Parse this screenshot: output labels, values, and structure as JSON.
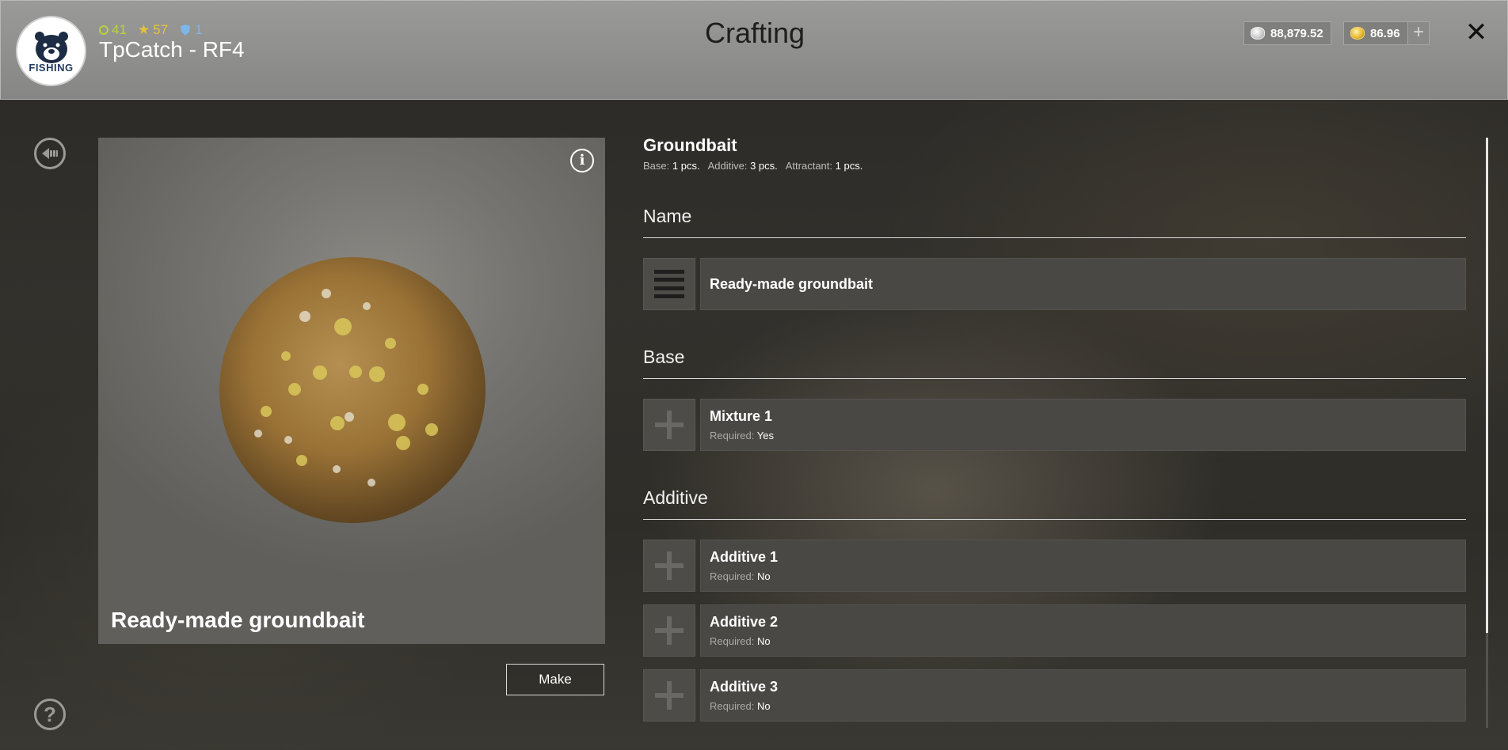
{
  "header": {
    "title": "Crafting",
    "player_name": "TpCatch - RF4",
    "stats": {
      "xp": "41",
      "rank": "57",
      "shield": "1"
    },
    "currency": {
      "silver": "88,879.52",
      "gold": "86.96",
      "add_label": "+"
    },
    "close_label": "✕",
    "logo_text": "FISHING"
  },
  "preview": {
    "item_name": "Ready-made groundbait",
    "info_label": "i",
    "make_label": "Make"
  },
  "recipe": {
    "title": "Groundbait",
    "counts": {
      "base_label": "Base:",
      "base_value": "1 pcs.",
      "additive_label": "Additive:",
      "additive_value": "3 pcs.",
      "attractant_label": "Attractant:",
      "attractant_value": "1 pcs."
    },
    "name_section": {
      "label": "Name",
      "value": "Ready-made groundbait"
    },
    "base_section": {
      "label": "Base",
      "slots": [
        {
          "title": "Mixture 1",
          "required_label": "Required:",
          "required_value": "Yes"
        }
      ]
    },
    "additive_section": {
      "label": "Additive",
      "slots": [
        {
          "title": "Additive 1",
          "required_label": "Required:",
          "required_value": "No"
        },
        {
          "title": "Additive 2",
          "required_label": "Required:",
          "required_value": "No"
        },
        {
          "title": "Additive 3",
          "required_label": "Required:",
          "required_value": "No"
        }
      ]
    }
  },
  "icons": {
    "back": "back-arrow-icon",
    "help": "question-icon",
    "help_glyph": "?",
    "info": "info-icon",
    "slot_empty": "plus-icon",
    "name_field": "text-lines-icon"
  },
  "colors": {
    "header_bg": "#8e8e8c",
    "xp": "#b9d43a",
    "star": "#e6c23a",
    "shield": "#7fb6e8",
    "slot_bg": "#4a4844"
  }
}
